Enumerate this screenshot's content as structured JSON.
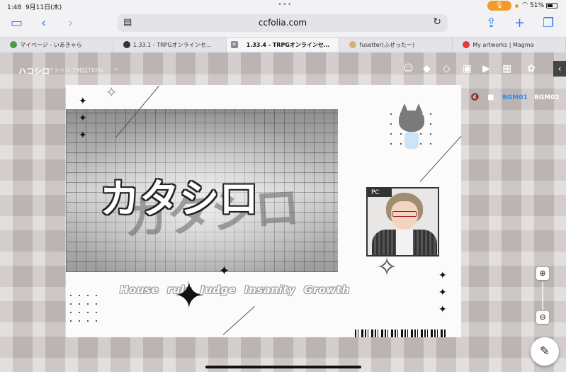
{
  "status": {
    "time": "1:48",
    "date": "9月11日(木)",
    "battery": "51%"
  },
  "browser": {
    "url": "ccfolia.com",
    "tabs": [
      {
        "label": "マイページ - いあきゃら",
        "color": "#4a9a4a"
      },
      {
        "label": "1.33.1 - TRPGオンラインセ…",
        "color": "#333333"
      },
      {
        "label": "1.33.4 - TRPGオンラインセ…",
        "active": true
      },
      {
        "label": "fusetter(ふせったー)",
        "color": "#d8b070"
      },
      {
        "label": "My artworks | Magma",
        "color": "#e03a3a"
      }
    ]
  },
  "room": {
    "title": "ハコシロ",
    "subtitle": "クトゥルフ神話TRPG"
  },
  "board": {
    "title": "カタシロ",
    "tagline": "House rule Judge Insanity Growth",
    "pc_label": "PC"
  },
  "bgm": {
    "track1": "BGM01",
    "track2": "BGM02",
    "active_color": "#2e8ef0",
    "volume_fraction": 0.9
  },
  "icons": {
    "sidebar": "sidebar-icon",
    "back": "chevron-left-icon",
    "forward": "chevron-right-icon",
    "share": "share-icon",
    "new_tab": "plus-icon",
    "tabs": "tabs-icon",
    "zoom_in": "zoom-in-icon",
    "zoom_out": "zoom-out-icon",
    "edit": "pencil-icon"
  }
}
